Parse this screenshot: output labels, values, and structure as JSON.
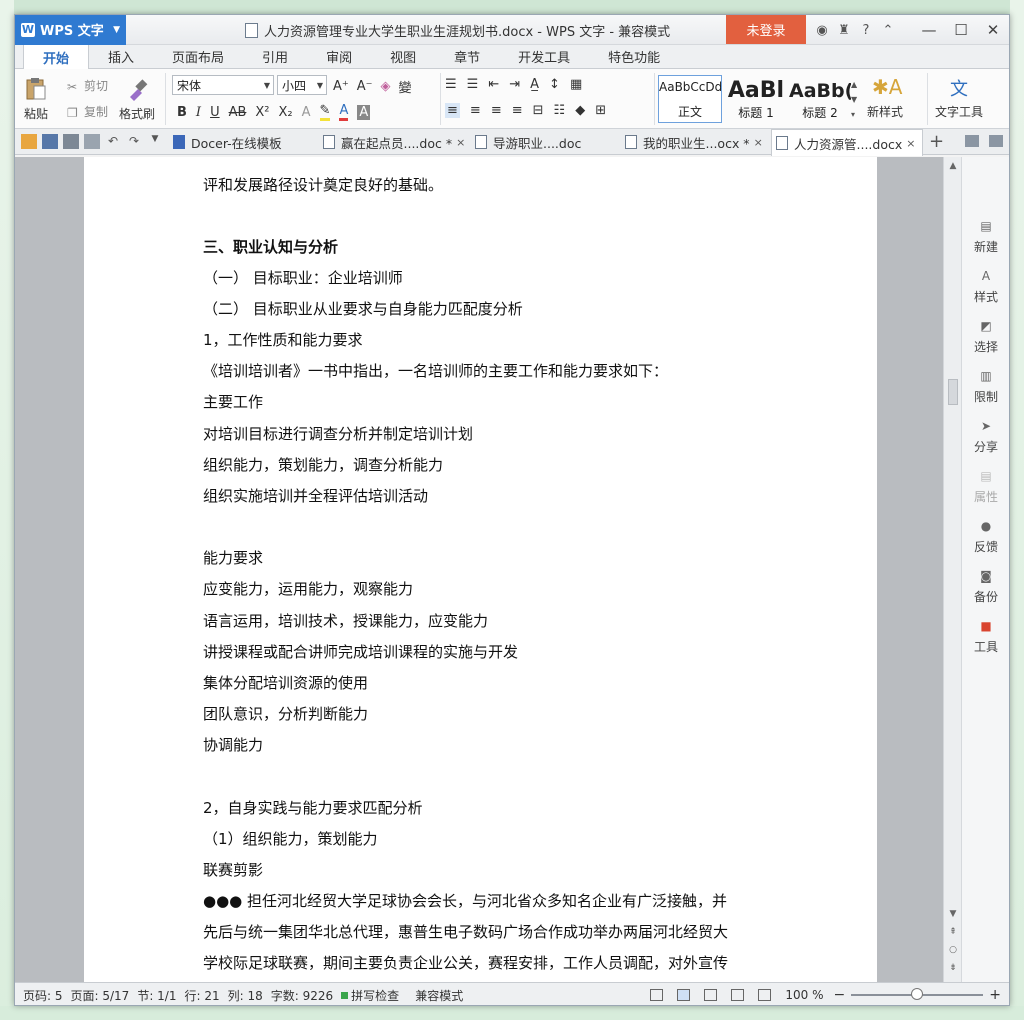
{
  "app": {
    "name": "WPS 文字",
    "title": "人力资源管理专业大学生职业生涯规划书.docx - WPS 文字 - 兼容模式",
    "login": "未登录"
  },
  "ribbon_tabs": [
    "开始",
    "插入",
    "页面布局",
    "引用",
    "审阅",
    "视图",
    "章节",
    "开发工具",
    "特色功能"
  ],
  "ribbon": {
    "paste": "粘贴",
    "cut": "剪切",
    "copy": "复制",
    "format_painter": "格式刷",
    "font_name": "宋体",
    "font_size": "小四",
    "styles": [
      {
        "preview": "AaBbCcDd",
        "label": "正文"
      },
      {
        "preview": "AaBl",
        "label": "标题 1"
      },
      {
        "preview": "AaBb(",
        "label": "标题 2"
      }
    ],
    "new_style": "新样式",
    "text_tools": "文字工具"
  },
  "doc_tabs": [
    {
      "label": "Docer-在线模板",
      "close": ""
    },
    {
      "label": "赢在起点员....doc *",
      "close": "×"
    },
    {
      "label": "导游职业....doc",
      "close": ""
    },
    {
      "label": "我的职业生...ocx *",
      "close": "×"
    },
    {
      "label": "人力资源管....docx",
      "close": "×"
    }
  ],
  "document_lines": [
    "评和发展路径设计奠定良好的基础。",
    "三、职业认知与分析",
    "（一） 目标职业：企业培训师",
    "（二） 目标职业从业要求与自身能力匹配度分析",
    "1，工作性质和能力要求",
    "《培训培训者》一书中指出，一名培训师的主要工作和能力要求如下：",
    "主要工作",
    "对培训目标进行调查分析并制定培训计划",
    "组织能力，策划能力，调查分析能力",
    "组织实施培训并全程评估培训活动",
    "能力要求",
    "应变能力，运用能力，观察能力",
    "语言运用，培训技术，授课能力，应变能力",
    "讲授课程或配合讲师完成培训课程的实施与开发",
    "集体分配培训资源的使用",
    "团队意识，分析判断能力",
    "协调能力",
    "2，自身实践与能力要求匹配分析",
    "（1）组织能力，策划能力",
    "联赛剪影",
    "●●● 担任河北经贸大学足球协会会长，与河北省众多知名企业有广泛接触，并",
    "先后与统一集团华北总代理，惠普生电子数码广场合作成功举办两届河北经贸大",
    "学校际足球联赛，期间主要负责企业公关，赛程安排，工作人员调配，对外宣传"
  ],
  "task_pane": [
    "新建",
    "样式",
    "选择",
    "限制",
    "分享",
    "属性",
    "反馈",
    "备份",
    "工具"
  ],
  "status": {
    "page_num": "页码: 5",
    "pages": "页面: 5/17",
    "section": "节: 1/1",
    "row": "行: 21",
    "col": "列: 18",
    "words": "字数: 9226",
    "spell": "拼写检查",
    "compat": "兼容模式",
    "zoom": "100 %"
  },
  "colors": {
    "accent": "#2f7ad1",
    "login": "#e2603f"
  }
}
